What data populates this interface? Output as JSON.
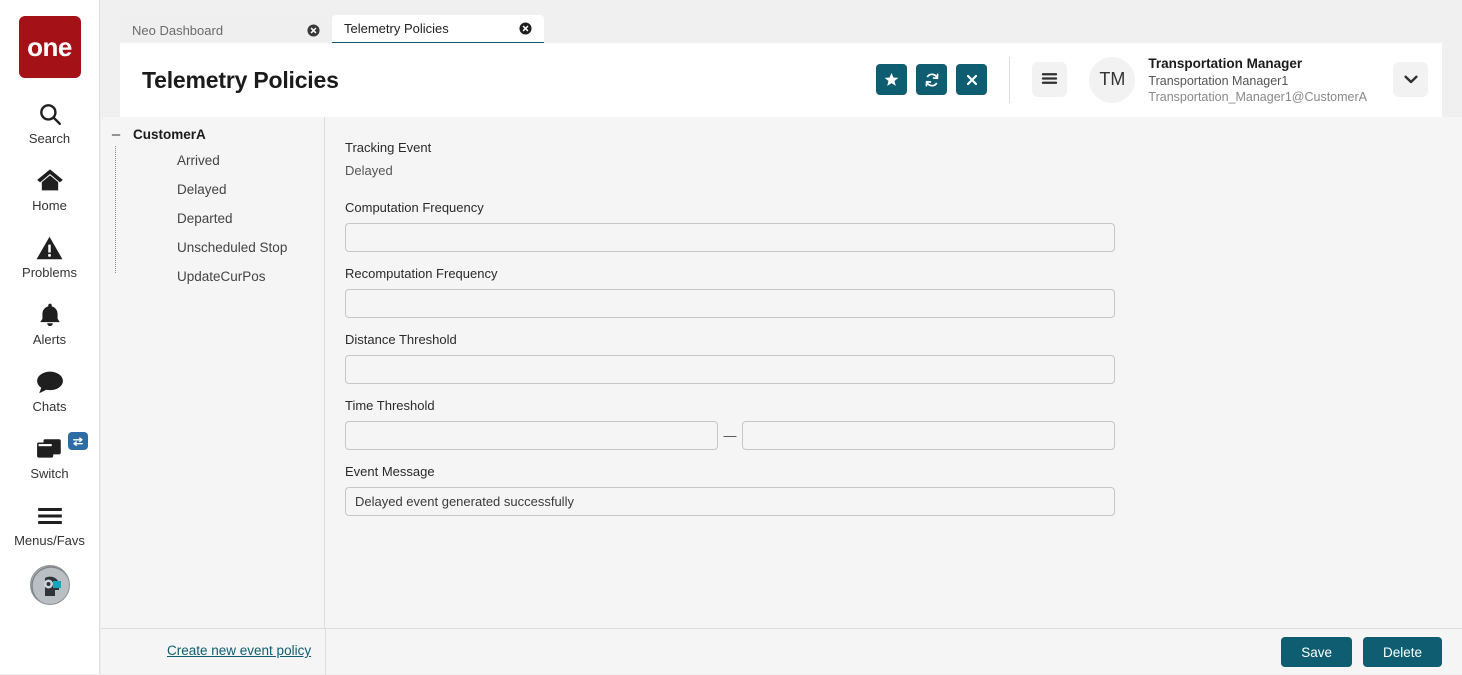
{
  "brand": {
    "logo_text": "one"
  },
  "rail": {
    "items": [
      {
        "label": "Search",
        "icon": "search-icon"
      },
      {
        "label": "Home",
        "icon": "home-icon"
      },
      {
        "label": "Problems",
        "icon": "warning-triangle-icon"
      },
      {
        "label": "Alerts",
        "icon": "bell-icon"
      },
      {
        "label": "Chats",
        "icon": "chat-bubble-icon"
      },
      {
        "label": "Switch",
        "icon": "windows-stack-icon",
        "badge_icon": "exchange-arrows-icon"
      },
      {
        "label": "Menus/Favs",
        "icon": "hamburger-icon"
      }
    ]
  },
  "tabs": [
    {
      "label": "Neo Dashboard",
      "active": false
    },
    {
      "label": "Telemetry Policies",
      "active": true
    }
  ],
  "header": {
    "title": "Telemetry Policies",
    "actions": [
      {
        "name": "favorite-button",
        "icon": "star-icon"
      },
      {
        "name": "refresh-button",
        "icon": "refresh-icon"
      },
      {
        "name": "close-button",
        "icon": "close-x-icon"
      }
    ],
    "menu_icon": "hamburger-icon",
    "chevron_icon": "chevron-down-icon"
  },
  "user": {
    "initials": "TM",
    "role": "Transportation Manager",
    "name": "Transportation Manager1",
    "email": "Transportation_Manager1@CustomerA"
  },
  "tree": {
    "root": "CustomerA",
    "collapse_glyph": "–",
    "items": [
      {
        "label": "Arrived"
      },
      {
        "label": "Delayed"
      },
      {
        "label": "Departed"
      },
      {
        "label": "Unscheduled Stop"
      },
      {
        "label": "UpdateCurPos"
      }
    ]
  },
  "form": {
    "tracking_event_label": "Tracking Event",
    "tracking_event_value": "Delayed",
    "computation_frequency_label": "Computation Frequency",
    "computation_frequency_value": "",
    "recomputation_frequency_label": "Recomputation Frequency",
    "recomputation_frequency_value": "",
    "distance_threshold_label": "Distance Threshold",
    "distance_threshold_value": "",
    "time_threshold_label": "Time Threshold",
    "time_threshold_from": "",
    "time_threshold_to": "",
    "time_threshold_separator": "—",
    "event_message_label": "Event Message",
    "event_message_value": "Delayed event generated successfully"
  },
  "footer": {
    "create_link": "Create new event policy",
    "save_label": "Save",
    "delete_label": "Delete"
  },
  "colors": {
    "accent_teal": "#0e5d70",
    "brand_red": "#a41117",
    "switch_badge_blue": "#2e6da4",
    "page_bg": "#f5f5f5"
  }
}
